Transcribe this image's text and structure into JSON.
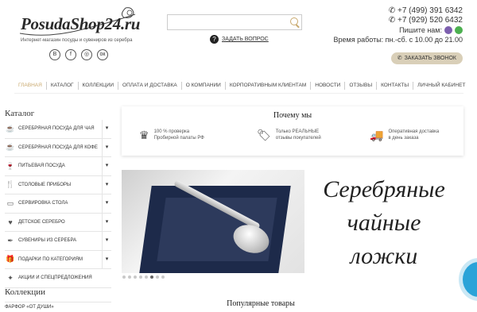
{
  "header": {
    "logo": "PosudaShop24.ru",
    "tagline": "Интернет-магазин посуды и сувениров из серебра",
    "socials": [
      "В",
      "f",
      "◎",
      "ок"
    ],
    "search_placeholder": "",
    "ask_label": "ЗАДАТЬ ВОПРОС",
    "phone1": "+7 (499) 391 6342",
    "phone2": "+7 (929) 520 6432",
    "write_us": "Пишите нам:",
    "hours": "Время работы: пн.-сб. с 10.00 до 21.00",
    "callback": "ЗАКАЗАТЬ ЗВОНОК"
  },
  "nav": [
    {
      "label": "ГЛАВНАЯ",
      "active": true
    },
    {
      "label": "КАТАЛОГ"
    },
    {
      "label": "КОЛЛЕКЦИИ"
    },
    {
      "label": "ОПЛАТА И ДОСТАВКА"
    },
    {
      "label": "О КОМПАНИИ"
    },
    {
      "label": "КОРПОРАТИВНЫМ КЛИЕНТАМ"
    },
    {
      "label": "НОВОСТИ"
    },
    {
      "label": "ОТЗЫВЫ"
    },
    {
      "label": "КОНТАКТЫ"
    },
    {
      "label": "ЛИЧНЫЙ КАБИНЕТ"
    }
  ],
  "sidebar": {
    "title": "Каталог",
    "items": [
      {
        "label": "СЕРЕБРЯНАЯ ПОСУДА ДЛЯ ЧАЯ",
        "icon": "teapot-icon",
        "glyph": "☕"
      },
      {
        "label": "СЕРЕБРЯНАЯ ПОСУДА ДЛЯ КОФЕ",
        "icon": "coffee-icon",
        "glyph": "☕"
      },
      {
        "label": "ПИТЬЕВАЯ ПОСУДА",
        "icon": "glass-icon",
        "glyph": "🍷"
      },
      {
        "label": "СТОЛОВЫЕ ПРИБОРЫ",
        "icon": "cutlery-icon",
        "glyph": "🍴"
      },
      {
        "label": "СЕРВИРОВКА СТОЛА",
        "icon": "tray-icon",
        "glyph": "▭"
      },
      {
        "label": "ДЕТСКОЕ СЕРЕБРО",
        "icon": "rattle-icon",
        "glyph": "♥"
      },
      {
        "label": "СУВЕНИРЫ ИЗ СЕРЕБРА",
        "icon": "souvenir-icon",
        "glyph": "✒"
      },
      {
        "label": "ПОДАРКИ ПО КАТЕГОРИЯМ",
        "icon": "gift-icon",
        "glyph": "🎁"
      },
      {
        "label": "АКЦИИ И СПЕЦПРЕДЛОЖЕНИЯ",
        "icon": "sale-icon",
        "glyph": "✦"
      }
    ],
    "collections_title": "Коллекции",
    "collection_first": "ФАРФОР «ОТ ДУШИ»"
  },
  "why": {
    "title": "Почему мы",
    "features": [
      {
        "icon": "crown-icon",
        "glyph": "♛",
        "line1": "100 % проверка",
        "line2": "Пробирной палаты РФ"
      },
      {
        "icon": "tag-icon",
        "glyph": "🏷",
        "line1": "Только РЕАЛЬНЫЕ",
        "line2": "отзывы покупателей"
      },
      {
        "icon": "truck-icon",
        "glyph": "🚚",
        "line1": "Оперативная доставка",
        "line2": "в день заказа"
      }
    ]
  },
  "banner": {
    "line1": "Серебряные",
    "line2": "чайные",
    "line3": "ложки"
  },
  "popular_title": "Популярные товары"
}
